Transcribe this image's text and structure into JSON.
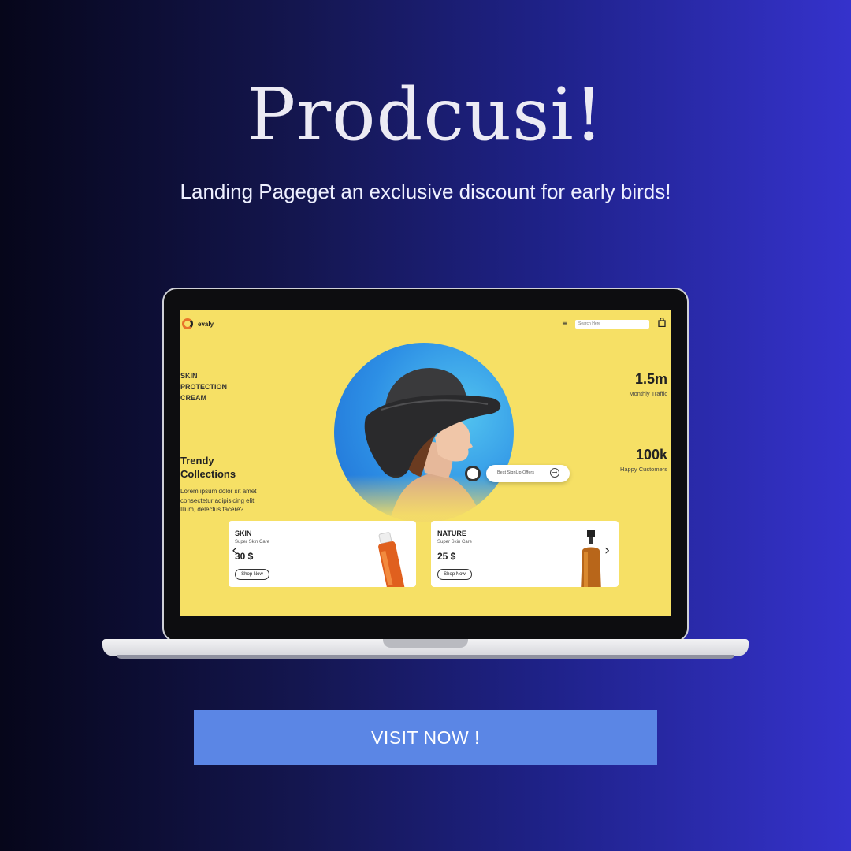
{
  "headline": "Prodcusi!",
  "subheadline": "Landing Pageget an exclusive discount for early birds!",
  "cta_label": "VISIT NOW !",
  "site": {
    "logo_text": "evaly",
    "search_placeholder": "Search Here",
    "hero_tag": [
      "SKIN",
      "PROTECTION",
      "CREAM"
    ],
    "section_title": [
      "Trendy",
      "Collections"
    ],
    "section_body": [
      "Lorem ipsum dolor sit amet",
      "consectetur adipisicing elit.",
      "Illum, delectus facere?"
    ],
    "signup_label": "Best SignUp Offers",
    "stats": [
      {
        "value": "1.5m",
        "label": "Monthly Traffic"
      },
      {
        "value": "100k",
        "label": "Happy Customers"
      }
    ],
    "cards": [
      {
        "name": "SKIN",
        "subtitle": "Super Skin Care",
        "price": "30 $",
        "button": "Shop Now"
      },
      {
        "name": "NATURE",
        "subtitle": "Super Skin Care",
        "price": "25 $",
        "button": "Shop Now"
      }
    ]
  },
  "colors": {
    "screen_bg": "#f6e065",
    "cta_bg": "#5b86e5",
    "accent_orange": "#e8742a"
  }
}
